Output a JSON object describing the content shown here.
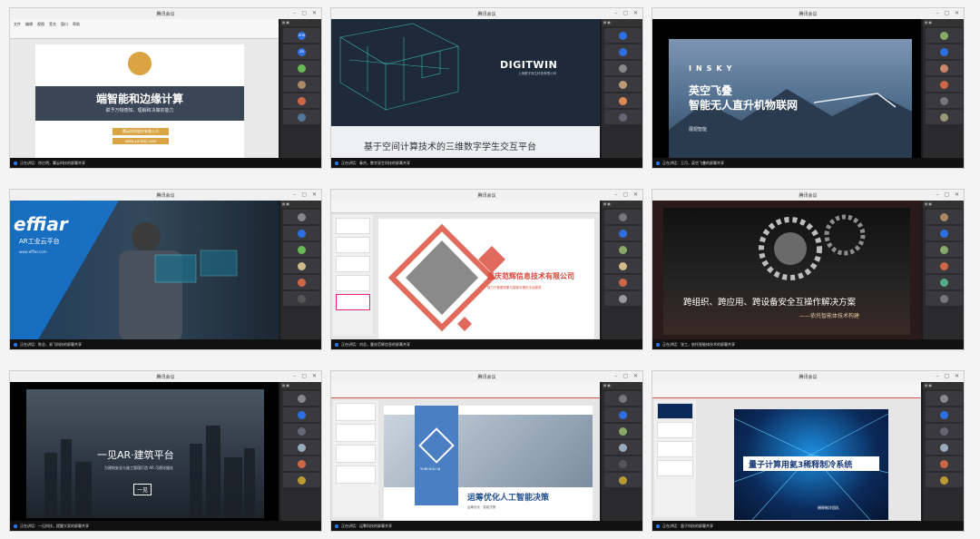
{
  "window_title": "腾讯会议",
  "panels": [
    {
      "footer": "正在讲话：徐亿明，翼云科技的屏幕共享",
      "slide": {
        "title": "端智能和边缘计算",
        "subtitle": "赋予万物感知、理解和决策的能力",
        "company": "翼云科技股份有限公司",
        "url": "www.yunkeji.com",
        "menu": [
          "文件",
          "编辑",
          "视图",
          "签名",
          "窗口",
          "帮助"
        ]
      },
      "participants": [
        "ZHR",
        "ZR",
        "",
        "",
        "",
        ""
      ]
    },
    {
      "footer": "正在讲话：秦杰，数字双生科技的屏幕共享",
      "slide": {
        "brand": "DIGITWIN",
        "company": "上海数字双生科技有限公司",
        "title": "基于空间计算技术的三维数字学生交互平台"
      },
      "participants": [
        "",
        "",
        "",
        "",
        "",
        ""
      ]
    },
    {
      "footer": "正在讲话：王月，英空飞叠的屏幕共享",
      "slide": {
        "brand": "INSKY",
        "title_l1": "英空飞叠",
        "title_l2": "智能无人直升机物联网",
        "subtitle": "展翅智能"
      },
      "participants": [
        "",
        "",
        "",
        "",
        "",
        ""
      ]
    },
    {
      "footer": "正在讲话：陈总，易飞科技的屏幕共享",
      "slide": {
        "brand": "effiar",
        "subtitle": "AR工业云平台",
        "url": "www.effiar.com"
      },
      "participants": [
        "",
        "",
        "",
        "",
        "",
        ""
      ]
    },
    {
      "footer": "正在讲话：刘总，重庆范辉信息的屏幕共享",
      "slide": {
        "company": "重庆范辉信息技术有限公司",
        "desc": "致力于数据采集与智能可视化平台服务"
      },
      "participants": [
        "",
        "",
        "",
        "",
        "",
        ""
      ]
    },
    {
      "footer": "正在讲话：张工，依托智能体技术的屏幕共享",
      "slide": {
        "title": "跨组织、跨应用、跨设备安全互操作解决方案",
        "subtitle": "——依托智能体技术构建"
      },
      "participants": [
        "",
        "",
        "",
        "",
        "",
        ""
      ]
    },
    {
      "footer": "正在讲话：一见科技，提醒大家的屏幕共享",
      "slide": {
        "title": "一见AR·建筑平台",
        "subtitle": "为建筑安全与施工管理打造 AR 可视化服务",
        "brand": "一见"
      },
      "participants": [
        "",
        "",
        "",
        "",
        "",
        ""
      ]
    },
    {
      "footer": "正在讲话：运筹科技的屏幕共享",
      "slide": {
        "title": "运筹优化人工智能决策",
        "subtitle": "运筹优化 · 智能决策",
        "brand": "YUNCHOU AI"
      },
      "participants": [
        "",
        "",
        "",
        "",
        "",
        ""
      ]
    },
    {
      "footer": "正在讲话：量子科技的屏幕共享",
      "slide": {
        "title_l1": "量子计算用氦3稀释制冷系统",
        "author": "稀释制冷团队"
      },
      "participants": [
        "",
        "",
        "",
        "",
        "",
        ""
      ]
    }
  ],
  "colors": {
    "accent": "#2d7cff",
    "bg": "#f4f4f4"
  }
}
